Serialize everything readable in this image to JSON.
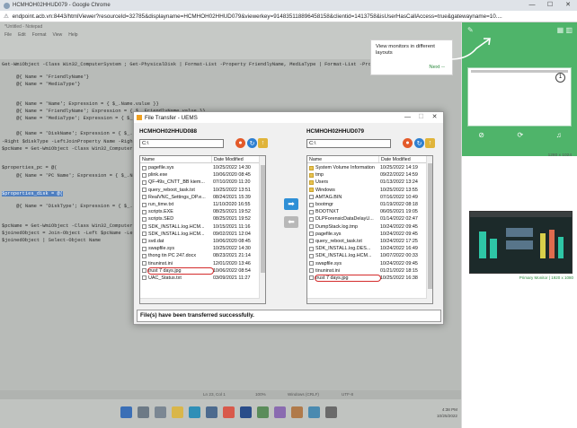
{
  "browser": {
    "title": "HCMHOH02HHUD079 - Google Chrome",
    "url": "endpoint.acb.vn:8443/htmlViewer?resourceId=32785&displayname=HCMHOH02HHUD079&viewerkey=914835118896458158&clientid=1413758&isUserHasCallAccess=true&gatewayname=10....",
    "minimize": "—",
    "maximize": "☐",
    "close": "✕"
  },
  "ise": {
    "title": "*Untitled - Notepad",
    "menu": [
      "File",
      "Edit",
      "Format",
      "View",
      "Help"
    ],
    "status": "Ln 23, Col 1",
    "zoom": "100%",
    "eol": "Windows (CRLF)",
    "encoding": "UTF-8"
  },
  "code_lines": [
    "Get-WmiObject -Class Win32_ComputerSystem ; Get-PhysicalDisk | Format-List -Property FriendlyName, MediaType | Format-List -Prop",
    "     @{ Name = 'FriendlyName'}",
    "     @{ Name = 'MediaType'}",
    "     @{ Name = 'Name'; Expression = { $_.Name.value }}",
    "     @{ Name = 'FriendlyName'; Expression = { $_.FriendlyName.value }}",
    "     @{ Name = 'MediaType'; Expression = { $_.MediaType.value }}",
    "     @{ Name = 'DiskName'; Expression = { $_.F",
    "-Right $diskType -LeftJoinProperty Name -Right",
    "$pcName = Get-WmiObject -Class Win32_Computer",
    "$properties_pc = @(",
    "     @{ Name = 'PC Name'; Expression = { $_.Na",
    "$properties_disk = @(",
    "     @{ Name = 'DiskType'; Expression = { $_.F",
    "$pcName = Get-WmiObject -Class Win32_Computer",
    "$joinedObject = Join-Object -Left $pcName -Le",
    "$joinedObject | Select-Object Name"
  ],
  "dialog": {
    "title": "File Transfer - UEMS",
    "left": {
      "host": "HCMHOH02HHUD088",
      "path": "C:\\",
      "col_name": "Name",
      "col_date": "Date Modified",
      "files": [
        {
          "name": "pagefile.sys",
          "date": "10/25/2022 14:30",
          "folder": false
        },
        {
          "name": "plink.exe",
          "date": "10/06/2020 08:45",
          "folder": false
        },
        {
          "name": "QF-49s_CNTT_BB kiem...",
          "date": "07/10/2020 11:20",
          "folder": false
        },
        {
          "name": "query_reboot_task.txt",
          "date": "10/25/2022 13:51",
          "folder": false
        },
        {
          "name": "RealVNC_Settings_DP.e...",
          "date": "08/24/2021 15:39",
          "folder": false
        },
        {
          "name": "run_time.txt",
          "date": "11/10/2020 16:55",
          "folder": false
        },
        {
          "name": "scripts.EXE",
          "date": "08/25/2021 19:52",
          "folder": false
        },
        {
          "name": "scripts.SED",
          "date": "08/25/2021 19:52",
          "folder": false
        },
        {
          "name": "SDK_INSTALL.log.HCM...",
          "date": "10/15/2021 11:16",
          "folder": false
        },
        {
          "name": "SDK_INSTALL.log.HCM...",
          "date": "09/02/2021 12:04",
          "folder": false
        },
        {
          "name": "svd.dat",
          "date": "10/06/2020 08:45",
          "folder": false
        },
        {
          "name": "swapfile.sys",
          "date": "10/25/2022 14:30",
          "folder": false
        },
        {
          "name": "thong tin PC 247.docx",
          "date": "08/23/2021 21:14",
          "folder": false
        },
        {
          "name": "tinuninst.ini",
          "date": "12/01/2020 13:46",
          "folder": false
        },
        {
          "name": "trust 7 days.jpg",
          "date": "10/06/2022 08:54",
          "folder": false,
          "circled": true
        },
        {
          "name": "UAC_Status.txt",
          "date": "03/09/2021 11:27",
          "folder": false
        }
      ]
    },
    "right": {
      "host": "HCMHOH02HHUD079",
      "path": "C:\\",
      "col_name": "Name",
      "col_date": "Date Modified",
      "files": [
        {
          "name": "System Volume Information",
          "date": "10/25/2022 14:19",
          "folder": true
        },
        {
          "name": "tmp",
          "date": "09/22/2022 14:59",
          "folder": true
        },
        {
          "name": "Users",
          "date": "01/13/2022 13:24",
          "folder": true
        },
        {
          "name": "Windows",
          "date": "10/25/2022 13:55",
          "folder": true
        },
        {
          "name": "AMTAG.BIN",
          "date": "07/16/2022 10:49",
          "folder": false
        },
        {
          "name": "bootmgr",
          "date": "01/19/2022 08:18",
          "folder": false
        },
        {
          "name": "BOOTNXT",
          "date": "06/05/2021 19:05",
          "folder": false
        },
        {
          "name": "DLPForensicDataDelayU...",
          "date": "01/14/2022 02:47",
          "folder": false
        },
        {
          "name": "DumpStack.log.tmp",
          "date": "10/24/2022 09:45",
          "folder": false
        },
        {
          "name": "pagefile.sys",
          "date": "10/24/2022 09:45",
          "folder": false
        },
        {
          "name": "query_reboot_task.txt",
          "date": "10/24/2022 17:25",
          "folder": false
        },
        {
          "name": "SDK_INSTALL.log.DES...",
          "date": "10/24/2022 16:49",
          "folder": false
        },
        {
          "name": "SDK_INSTALL.log.HCM...",
          "date": "10/07/2022 00:33",
          "folder": false
        },
        {
          "name": "swapfile.sys",
          "date": "10/24/2022 09:45",
          "folder": false
        },
        {
          "name": "tinuninst.ini",
          "date": "01/21/2022 18:15",
          "folder": false
        },
        {
          "name": "trust 7 days.jpg",
          "date": "10/25/2022 16:38",
          "folder": false,
          "circled": true
        }
      ]
    },
    "status": "File(s) have been transferred successfully.",
    "ctrl_min": "—",
    "ctrl_max": "☐",
    "ctrl_close": "✕"
  },
  "rightpanel": {
    "tooltip": "View monitors in different layouts",
    "next": "Next --",
    "monitor1_res": "1280 x 1024",
    "monitor1_num": "1",
    "monitor2_res": "Primary Monitor | 1920 x 1080"
  },
  "taskbar": {
    "time": "4:38 PM",
    "date": "10/25/2022"
  },
  "colors": {
    "accent_green": "#4fb46a",
    "transfer_blue": "#2e8fd6",
    "circle_red": "#d42b2b",
    "selection_blue": "#4f7fc0"
  },
  "icons": {
    "lock": "lock-icon",
    "refresh": "refresh-icon",
    "up": "up-folder-icon",
    "right_arrow": "arrow-right-icon",
    "left_arrow": "arrow-left-icon"
  }
}
